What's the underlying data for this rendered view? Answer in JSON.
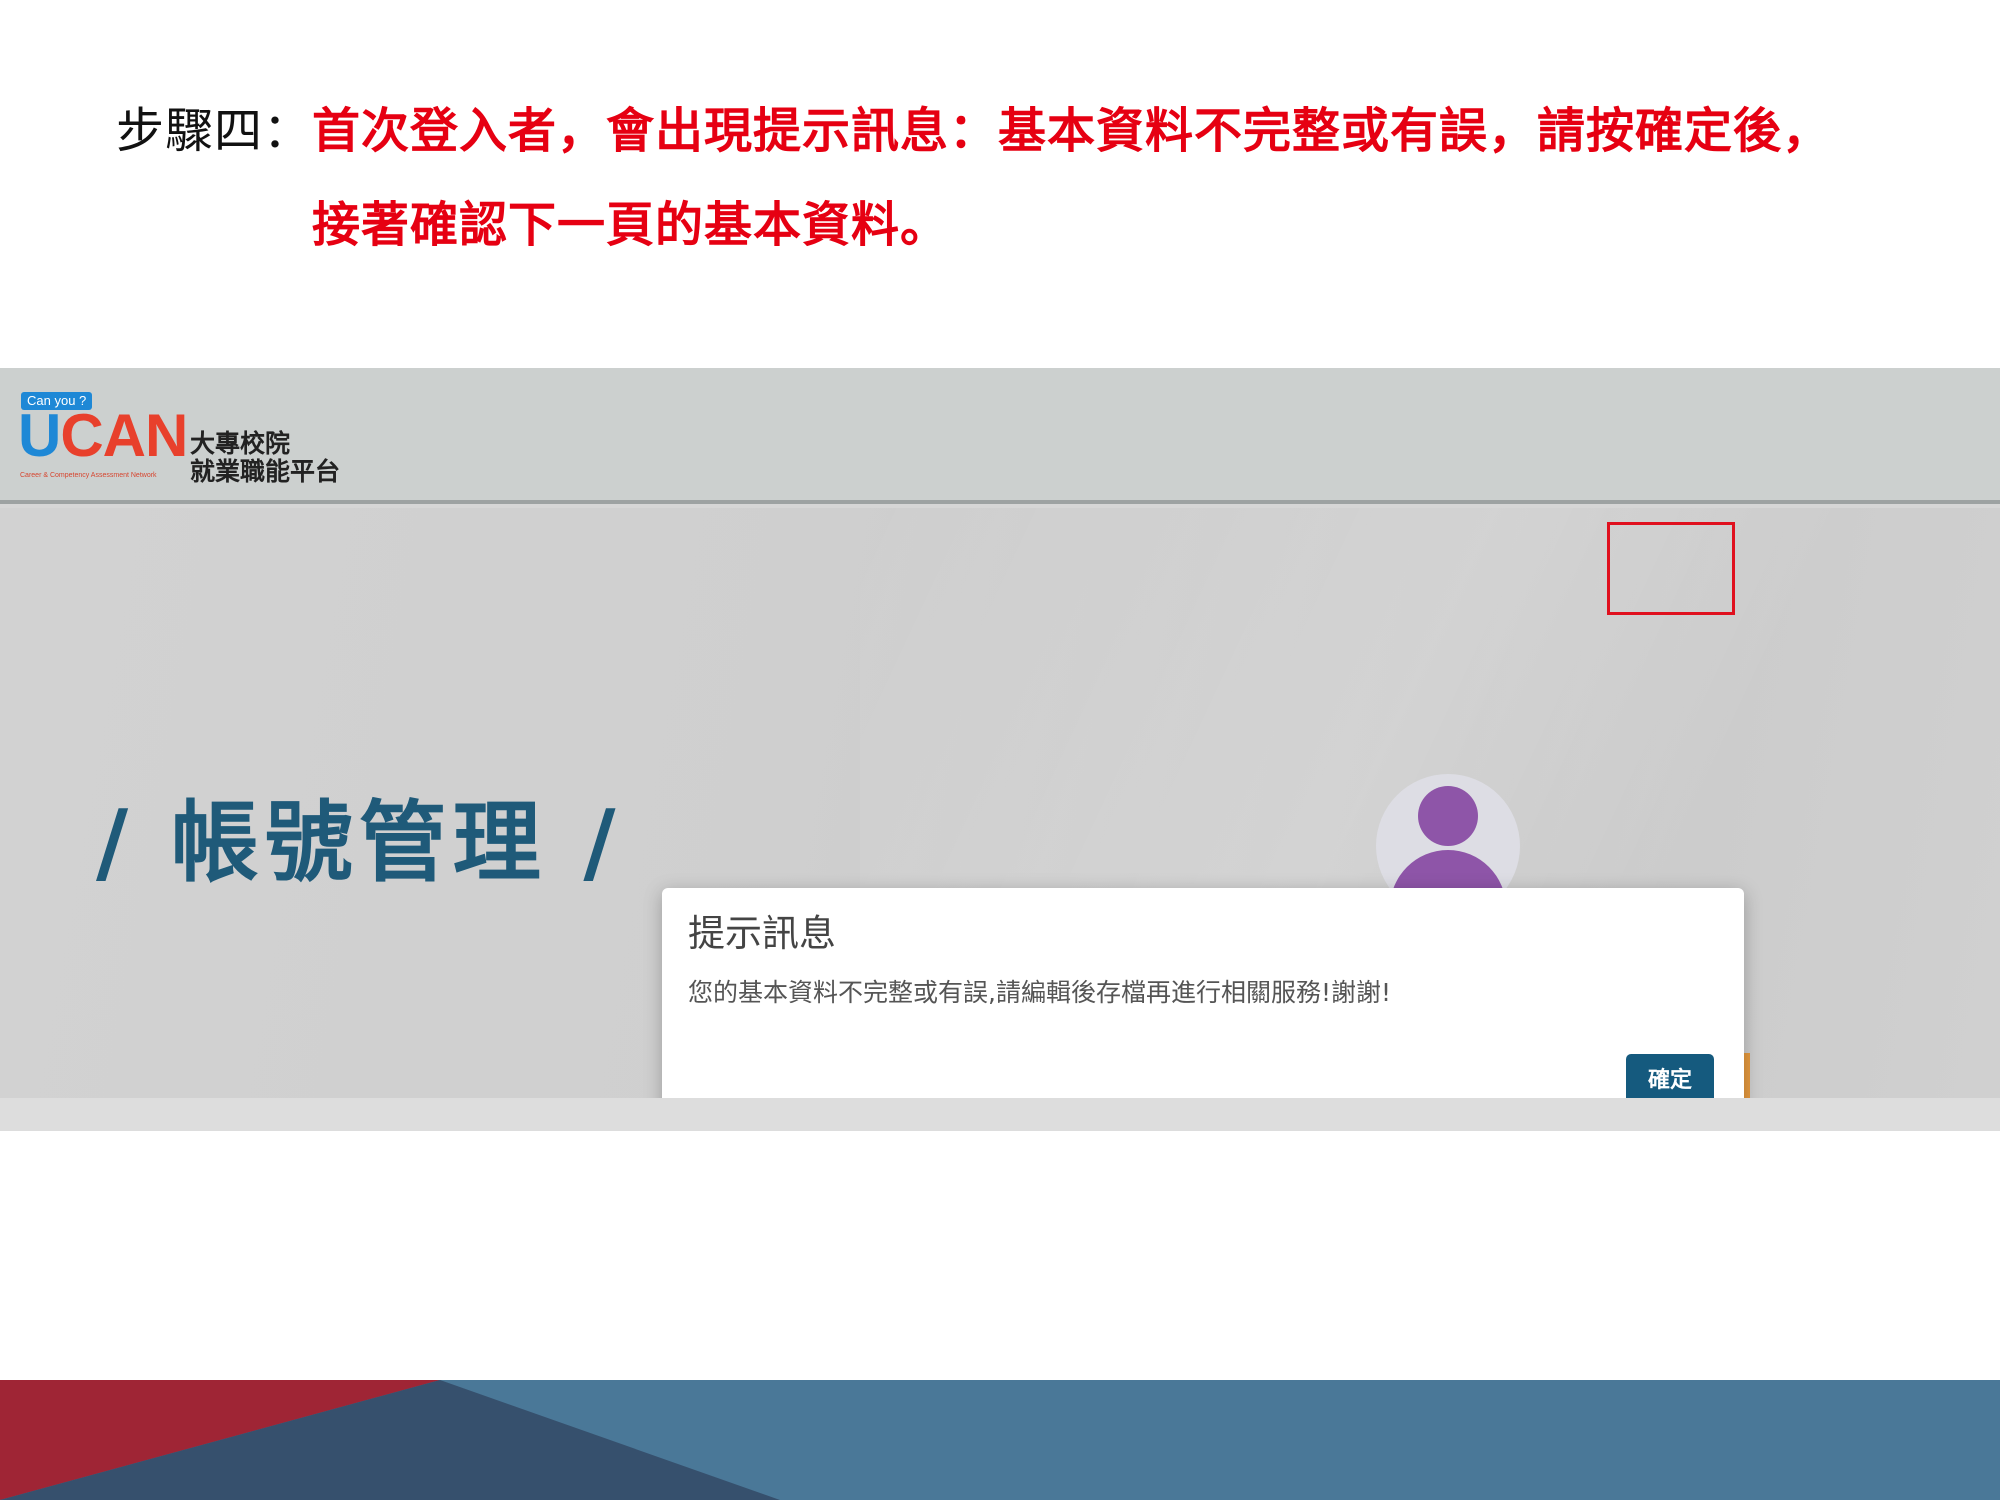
{
  "instruction": {
    "prefix": "步驟四：",
    "line1": "首次登入者，會出現提示訊息：基本資料不完整或有誤，請按確定後，",
    "line2": "接著確認下一頁的基本資料。"
  },
  "site": {
    "logo_badge": "Can you ?",
    "logo_u": "U",
    "logo_can": "CAN",
    "logo_tagline": "Career & Competency Assessment Network",
    "logo_cn_line1": "大專校院",
    "logo_cn_line2": "就業職能平台"
  },
  "page": {
    "heading": "/ 帳號管理 /"
  },
  "dialog": {
    "title": "提示訊息",
    "message": "您的基本資料不完整或有誤,請編輯後存檔再進行相關服務!謝謝!",
    "ok_label": "確定"
  },
  "colors": {
    "instruction_red": "#e60012",
    "heading_blue": "#1f5a79",
    "button_blue": "#155a7e",
    "highlight_red": "#e0101e",
    "avatar_purple": "#8e55a8"
  },
  "icons": {
    "avatar": "user-avatar-icon"
  }
}
